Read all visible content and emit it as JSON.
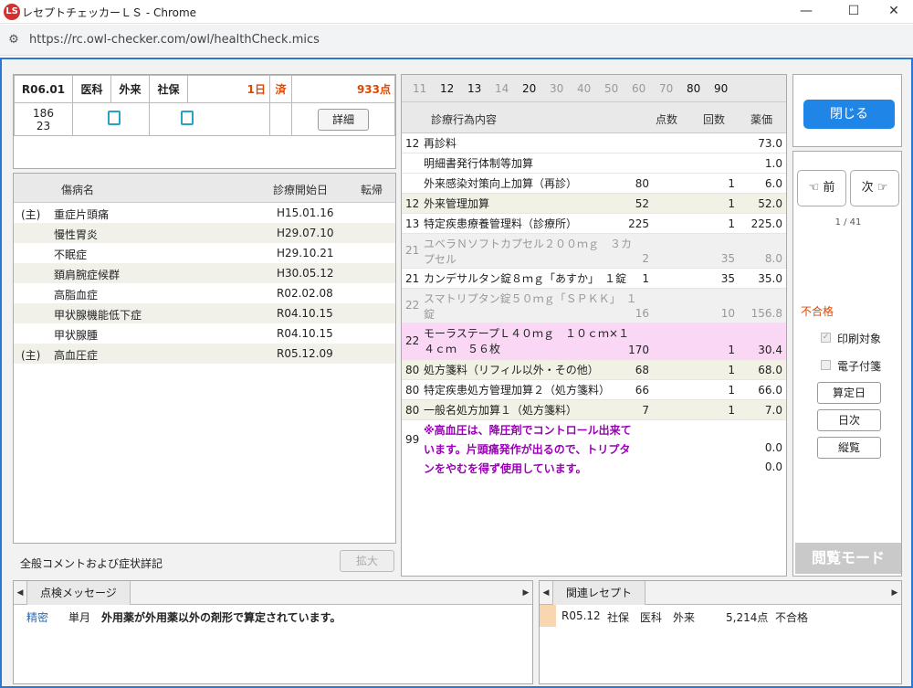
{
  "window": {
    "title": "レセプトチェッカーＬＳ - Chrome",
    "app_icon": "LS",
    "url": "https://rc.owl-checker.com/owl/healthCheck.mics",
    "minimize": "—",
    "maximize": "☐",
    "close": "✕"
  },
  "header": {
    "date": "R06.01",
    "dept": "医科",
    "type": "外来",
    "insurance": "社保",
    "days": "1日",
    "done": "済",
    "points": "933点",
    "num1": "186",
    "num2": "23",
    "detail_button": "詳細"
  },
  "disease": {
    "col_name": "傷病名",
    "col_start": "診療開始日",
    "col_outcome": "転帰",
    "rows": [
      {
        "mark": "(主)",
        "name": "重症片頭痛",
        "date": "H15.01.16"
      },
      {
        "mark": "",
        "name": "慢性胃炎",
        "date": "H29.07.10"
      },
      {
        "mark": "",
        "name": "不眠症",
        "date": "H29.10.21"
      },
      {
        "mark": "",
        "name": "頚肩腕症候群",
        "date": "H30.05.12"
      },
      {
        "mark": "",
        "name": "高脂血症",
        "date": "R02.02.08"
      },
      {
        "mark": "",
        "name": "甲状腺機能低下症",
        "date": "R04.10.15"
      },
      {
        "mark": "",
        "name": "甲状腺腫",
        "date": "R04.10.15"
      },
      {
        "mark": "(主)",
        "name": "高血圧症",
        "date": "R05.12.09"
      }
    ],
    "comment_label": "全般コメントおよび症状詳記",
    "expand_button": "拡大"
  },
  "treatment": {
    "days": [
      "11",
      "12",
      "13",
      "14",
      "20",
      "30",
      "40",
      "50",
      "60",
      "70",
      "80",
      "90"
    ],
    "active_days": [
      "12",
      "13",
      "20",
      "80",
      "90"
    ],
    "col_content": "診療行為内容",
    "col_points": "点数",
    "col_count": "回数",
    "col_price": "薬価",
    "rows": [
      {
        "code": "12",
        "content": "再診料",
        "points": "",
        "count": "",
        "price": "73.0"
      },
      {
        "code": "",
        "content": "明細書発行体制等加算",
        "points": "",
        "count": "",
        "price": "1.0"
      },
      {
        "code": "",
        "content": "外来感染対策向上加算（再診）",
        "points": "80",
        "count": "1",
        "price": "6.0"
      },
      {
        "code": "12",
        "content": "外来管理加算",
        "points": "52",
        "count": "1",
        "price": "52.0"
      },
      {
        "code": "13",
        "content": "特定疾患療養管理料（診療所）",
        "points": "225",
        "count": "1",
        "price": "225.0"
      },
      {
        "code": "21",
        "content": "ユベラＮソフトカプセル２００ｍｇ　３カプセル",
        "points": "2",
        "count": "35",
        "price": "8.0"
      },
      {
        "code": "21",
        "content": "カンデサルタン錠８ｍｇ「あすか」　１錠",
        "points": "1",
        "count": "35",
        "price": "35.0"
      },
      {
        "code": "22",
        "content": "スマトリプタン錠５０ｍｇ「ＳＰＫＫ」　１錠",
        "points": "16",
        "count": "10",
        "price": "156.8"
      },
      {
        "code": "22",
        "content": "モーラステープＬ４０ｍｇ　１０ｃｍ×１４ｃｍ　５６枚",
        "points": "170",
        "count": "1",
        "price": "30.4"
      },
      {
        "code": "80",
        "content": "処方箋料（リフィル以外・その他）",
        "points": "68",
        "count": "1",
        "price": "68.0"
      },
      {
        "code": "80",
        "content": "特定疾患処方管理加算２（処方箋料）",
        "points": "66",
        "count": "1",
        "price": "66.0"
      },
      {
        "code": "80",
        "content": "一般名処方加算１（処方箋料）",
        "points": "7",
        "count": "1",
        "price": "7.0"
      }
    ],
    "note_code": "99",
    "note_line1": "※高血圧は、降圧剤でコントロール出来て",
    "note_line2": "います。片頭痛発作が出るので、トリプタ",
    "note_line3": "ンをやむを得ず使用しています。",
    "note_price1": "0.0",
    "note_price2": "0.0"
  },
  "sidebar": {
    "close_button": "閉じる",
    "prev_button": "☜ 前",
    "next_button": "次 ☞",
    "page": "1 / 41",
    "status": "不合格",
    "print_label": "印刷対象",
    "etag_label": "電子付箋",
    "calc_button": "算定日",
    "daily_button": "日次",
    "vertical_button": "縦覧",
    "mode_label": "閲覧モード"
  },
  "check_messages": {
    "tab": "点検メッセージ",
    "rows": [
      {
        "type": "精密",
        "scope": "単月",
        "message": "外用薬が外用薬以外の剤形で算定されています。"
      }
    ]
  },
  "related": {
    "tab": "関連レセプト",
    "rows": [
      {
        "date": "R05.12",
        "insurance": "社保",
        "dept": "医科",
        "type": "外来",
        "points": "5,214点",
        "result": "不合格"
      }
    ]
  },
  "colors": {
    "accent": "#1f86e8",
    "frame": "#2b78d4",
    "error_red": "#e04800",
    "note_purple": "#9b00b8",
    "highlight_pink": "#fad7f5"
  }
}
